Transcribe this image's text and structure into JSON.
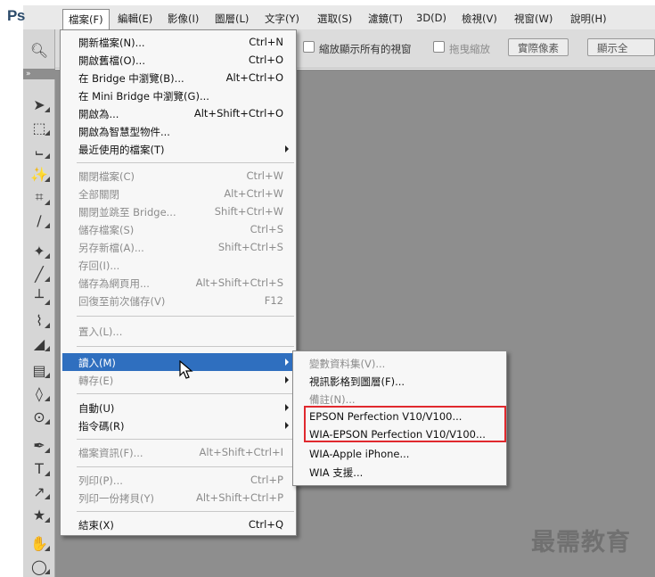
{
  "app": {
    "logo": "Ps"
  },
  "menubar": {
    "items": [
      "檔案(F)",
      "編輯(E)",
      "影像(I)",
      "圖層(L)",
      "文字(Y)",
      "選取(S)",
      "濾鏡(T)",
      "3D(D)",
      "檢視(V)",
      "視窗(W)",
      "說明(H)"
    ]
  },
  "options_bar": {
    "zoom_all_windows": "縮放顯示所有的視窗",
    "scrubby_zoom": "拖曳縮放",
    "actual_pixels": "實際像素",
    "fit_screen": "顯示全"
  },
  "tool_panel": {
    "collapse": "»",
    "tools": [
      "move-tool",
      "marquee-tool",
      "lasso-tool",
      "quick-select-tool",
      "crop-tool",
      "eyedropper-tool",
      "healing-brush-tool",
      "brush-tool",
      "clone-stamp-tool",
      "history-brush-tool",
      "eraser-tool",
      "gradient-tool",
      "blur-tool",
      "dodge-tool",
      "pen-tool",
      "type-tool",
      "path-select-tool",
      "shape-tool",
      "hand-tool",
      "zoom-tool"
    ]
  },
  "file_menu": {
    "items": [
      {
        "label": "開新檔案(N)...",
        "shortcut": "Ctrl+N",
        "enabled": true
      },
      {
        "label": "開啟舊檔(O)...",
        "shortcut": "Ctrl+O",
        "enabled": true
      },
      {
        "label": "在 Bridge 中瀏覽(B)...",
        "shortcut": "Alt+Ctrl+O",
        "enabled": true
      },
      {
        "label": "在 Mini Bridge 中瀏覽(G)...",
        "shortcut": "",
        "enabled": true
      },
      {
        "label": "開啟為...",
        "shortcut": "Alt+Shift+Ctrl+O",
        "enabled": true
      },
      {
        "label": "開啟為智慧型物件...",
        "shortcut": "",
        "enabled": true
      },
      {
        "label": "最近使用的檔案(T)",
        "shortcut": "",
        "enabled": true,
        "submenu": true
      },
      {
        "label": "關閉檔案(C)",
        "shortcut": "Ctrl+W",
        "enabled": false
      },
      {
        "label": "全部關閉",
        "shortcut": "Alt+Ctrl+W",
        "enabled": false
      },
      {
        "label": "關閉並跳至 Bridge...",
        "shortcut": "Shift+Ctrl+W",
        "enabled": false
      },
      {
        "label": "儲存檔案(S)",
        "shortcut": "Ctrl+S",
        "enabled": false
      },
      {
        "label": "另存新檔(A)...",
        "shortcut": "Shift+Ctrl+S",
        "enabled": false
      },
      {
        "label": "存回(I)...",
        "shortcut": "",
        "enabled": false
      },
      {
        "label": "儲存為網頁用...",
        "shortcut": "Alt+Shift+Ctrl+S",
        "enabled": false
      },
      {
        "label": "回復至前次儲存(V)",
        "shortcut": "F12",
        "enabled": false
      },
      {
        "label": "置入(L)...",
        "shortcut": "",
        "enabled": false
      },
      {
        "label": "讀入(M)",
        "shortcut": "",
        "enabled": true,
        "submenu": true,
        "highlighted": true
      },
      {
        "label": "轉存(E)",
        "shortcut": "",
        "enabled": false,
        "submenu": true
      },
      {
        "label": "自動(U)",
        "shortcut": "",
        "enabled": true,
        "submenu": true
      },
      {
        "label": "指令碼(R)",
        "shortcut": "",
        "enabled": true,
        "submenu": true
      },
      {
        "label": "檔案資訊(F)...",
        "shortcut": "Alt+Shift+Ctrl+I",
        "enabled": false
      },
      {
        "label": "列印(P)...",
        "shortcut": "Ctrl+P",
        "enabled": false
      },
      {
        "label": "列印一份拷貝(Y)",
        "shortcut": "Alt+Shift+Ctrl+P",
        "enabled": false
      },
      {
        "label": "結束(X)",
        "shortcut": "Ctrl+Q",
        "enabled": true
      }
    ]
  },
  "import_submenu": {
    "items": [
      {
        "label": "變數資料集(V)...",
        "enabled": false
      },
      {
        "label": "視訊影格到圖層(F)...",
        "enabled": true
      },
      {
        "label": "備註(N)...",
        "enabled": false
      },
      {
        "label": "EPSON Perfection V10/V100...",
        "enabled": true,
        "boxed": true
      },
      {
        "label": "WIA-EPSON Perfection V10/V100...",
        "enabled": true,
        "boxed": true
      },
      {
        "label": "WIA-Apple iPhone...",
        "enabled": true
      },
      {
        "label": "WIA 支援...",
        "enabled": true
      }
    ],
    "annotation_color": "#e0292e"
  },
  "colors": {
    "highlight": "#2f6fbf",
    "canvas": "#8e8e8e",
    "menu_bg": "#f7f7f7"
  },
  "watermark": "最需教育"
}
